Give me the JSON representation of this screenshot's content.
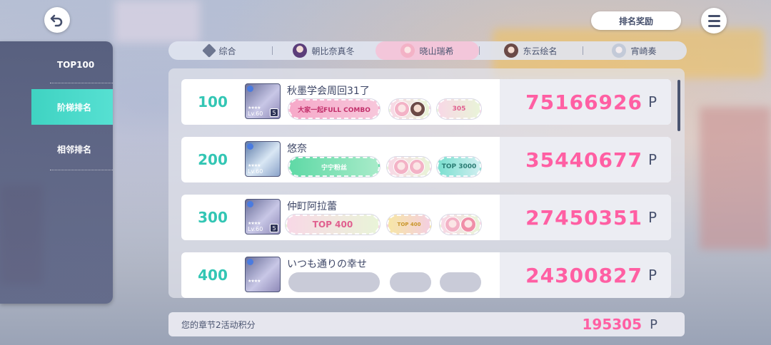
{
  "header": {
    "back_icon": "back-arrow-icon",
    "reward_label": "排名奖励",
    "menu_icon": "hamburger-menu-icon"
  },
  "tabs": [
    {
      "label": "综合",
      "icon": "diamond-icon",
      "active": false
    },
    {
      "label": "朝比奈真冬",
      "icon": "character-avatar",
      "active": false
    },
    {
      "label": "晓山瑞希",
      "icon": "character-avatar",
      "active": true
    },
    {
      "label": "东云绘名",
      "icon": "character-avatar",
      "active": false
    },
    {
      "label": "宵崎奏",
      "icon": "character-avatar",
      "active": false
    }
  ],
  "sidebar": {
    "items": [
      {
        "label": "TOP100",
        "active": false
      },
      {
        "label": "阶梯排名",
        "active": true
      },
      {
        "label": "相邻排名",
        "active": false
      }
    ]
  },
  "rows": [
    {
      "rank": "100",
      "name": "秋墨学会周回31了",
      "card_level": "Lv.60",
      "card_rank": "5",
      "badges": [
        "大家一起FULL COMBO",
        "",
        "305"
      ],
      "score": "75166926",
      "unit": "P"
    },
    {
      "rank": "200",
      "name": "悠奈",
      "card_level": "Lv.60",
      "card_rank": "",
      "badges": [
        "宁宁粉丝",
        "",
        "TOP 3000"
      ],
      "score": "35440677",
      "unit": "P"
    },
    {
      "rank": "300",
      "name": "仲町阿拉蕾",
      "card_level": "Lv.60",
      "card_rank": "5",
      "badges": [
        "TOP 400",
        "TOP 400",
        ""
      ],
      "score": "27450351",
      "unit": "P"
    },
    {
      "rank": "400",
      "name": "いつも通りの幸せ",
      "card_level": "",
      "card_rank": "",
      "badges": [
        "",
        "",
        ""
      ],
      "score": "24300827",
      "unit": "P"
    }
  ],
  "footer": {
    "label": "您的章节2活动积分",
    "score": "195305",
    "unit": "P"
  },
  "colors": {
    "accent_teal": "#33c6b4",
    "score_pink": "#ff5fa3",
    "active_tab": "#f3c6da"
  }
}
